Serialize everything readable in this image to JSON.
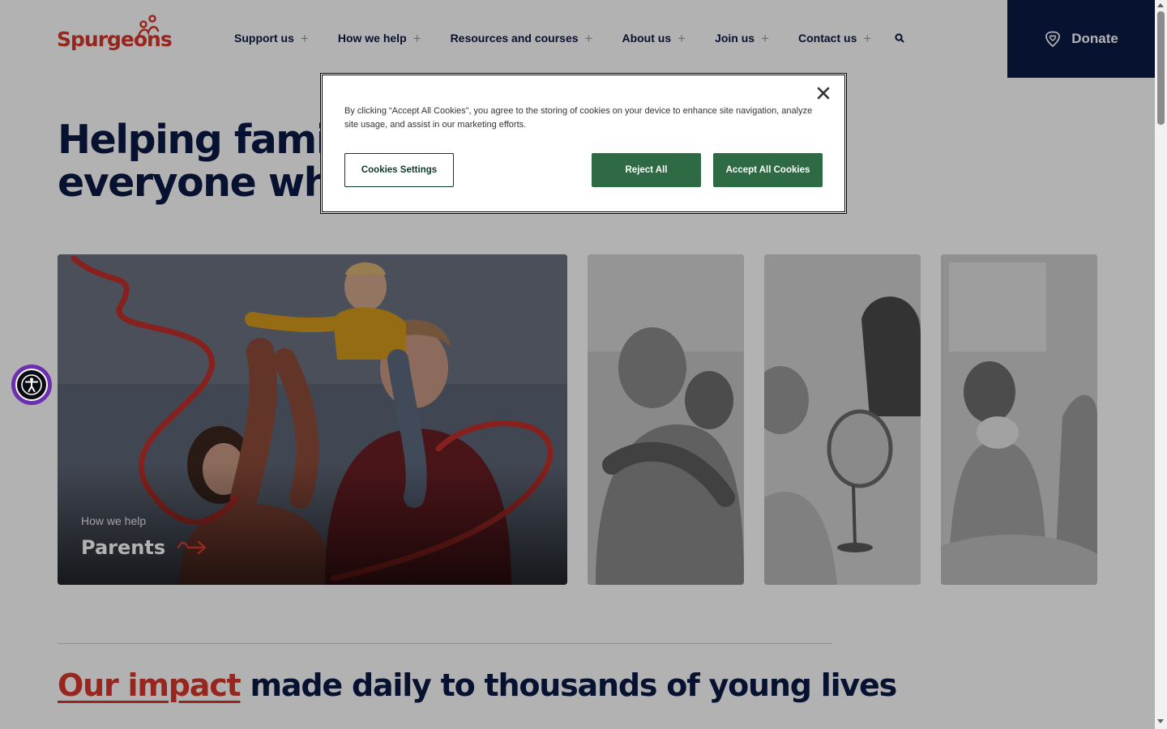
{
  "header": {
    "logo_text": "Spurgeons",
    "nav": [
      {
        "label": "Support us"
      },
      {
        "label": "How we help"
      },
      {
        "label": "Resources and courses"
      },
      {
        "label": "About us"
      },
      {
        "label": "Join us"
      },
      {
        "label": "Contact us"
      }
    ],
    "search_icon": "search-icon",
    "donate_label": "Donate"
  },
  "hero": {
    "title_line1": "Helping famili",
    "title_line2": "everyone who"
  },
  "cards": {
    "main": {
      "kicker": "How we help",
      "title": "Parents"
    }
  },
  "impact": {
    "highlight": "Our impact",
    "rest": " made daily to thousands of young lives"
  },
  "cookie_banner": {
    "text": "By clicking “Accept All Cookies”, you agree to the storing of cookies on your device to enhance site navigation, analyze site usage, and assist in our marketing efforts.",
    "settings_label": "Cookies Settings",
    "reject_label": "Reject All",
    "accept_label": "Accept All Cookies"
  },
  "colors": {
    "brand_red": "#d8392b",
    "navy": "#0b1a45",
    "cookie_green": "#2e6a44",
    "a11y_purple": "#6b2fb0"
  }
}
